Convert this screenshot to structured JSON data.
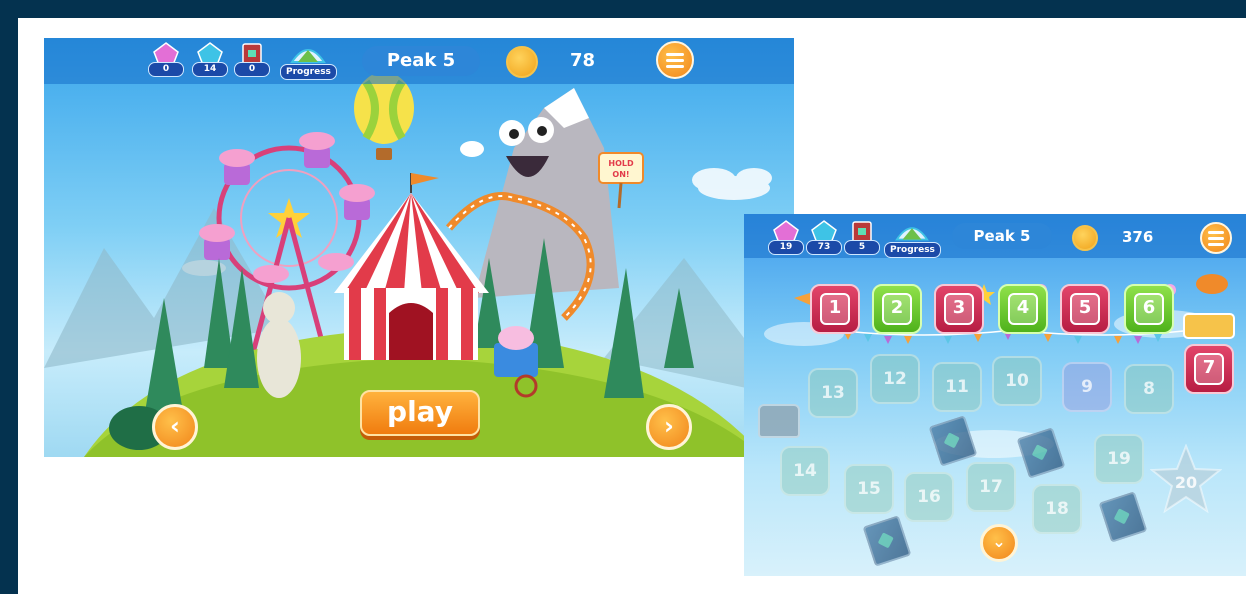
{
  "colors": {
    "frame_bg": "#04324f",
    "hud_bar": "#2d86d8",
    "accent_orange": "#f1851a",
    "level_red": "#c92752",
    "level_green": "#5cc224",
    "locked_level": "#8cc8b4"
  },
  "screen_map": {
    "hud": {
      "stats": [
        {
          "icon": "pink-gem-icon",
          "value": "0"
        },
        {
          "icon": "blue-gem-icon",
          "value": "14"
        },
        {
          "icon": "book-icon",
          "value": "0"
        }
      ],
      "progress_label": "Progress",
      "peak_title": "Peak 5",
      "coins": "78",
      "menu_icon": "hamburger-menu-icon"
    },
    "play_label": "play",
    "prev_icon": "chevron-left-icon",
    "next_icon": "chevron-right-icon"
  },
  "screen_levels": {
    "hud": {
      "stats": [
        {
          "icon": "pink-gem-icon",
          "value": "19"
        },
        {
          "icon": "blue-gem-icon",
          "value": "73"
        },
        {
          "icon": "book-icon",
          "value": "5"
        }
      ],
      "progress_label": "Progress",
      "peak_title": "Peak 5",
      "coins": "376",
      "menu_icon": "hamburger-menu-icon"
    },
    "levels": [
      {
        "num": "1",
        "state": "red"
      },
      {
        "num": "2",
        "state": "green"
      },
      {
        "num": "3",
        "state": "red"
      },
      {
        "num": "4",
        "state": "green"
      },
      {
        "num": "5",
        "state": "red"
      },
      {
        "num": "6",
        "state": "green"
      },
      {
        "num": "7",
        "state": "red"
      },
      {
        "num": "8",
        "state": "locked"
      },
      {
        "num": "9",
        "state": "locked"
      },
      {
        "num": "10",
        "state": "locked"
      },
      {
        "num": "11",
        "state": "locked"
      },
      {
        "num": "12",
        "state": "locked"
      },
      {
        "num": "13",
        "state": "locked"
      },
      {
        "num": "14",
        "state": "locked"
      },
      {
        "num": "15",
        "state": "locked"
      },
      {
        "num": "16",
        "state": "locked"
      },
      {
        "num": "17",
        "state": "locked"
      },
      {
        "num": "18",
        "state": "locked"
      },
      {
        "num": "19",
        "state": "locked"
      },
      {
        "num": "20",
        "state": "locked"
      }
    ],
    "scroll_down_icon": "chevron-down-icon"
  }
}
